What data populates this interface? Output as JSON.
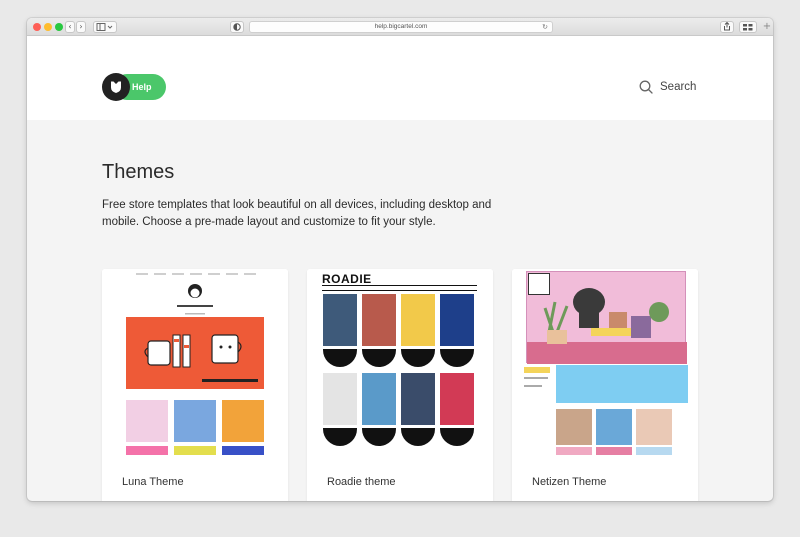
{
  "browser": {
    "url": "help.bigcartel.com",
    "back_glyph": "‹",
    "forward_glyph": "›",
    "reload_glyph": "↻",
    "new_tab_glyph": "+"
  },
  "header": {
    "logo_label": "Help",
    "search_label": "Search"
  },
  "main": {
    "title": "Themes",
    "description": "Free store templates that look beautiful on all devices, including desktop and mobile. Choose a pre-made layout and customize to fit your style."
  },
  "themes": [
    {
      "name": "Luna Theme"
    },
    {
      "name": "Roadie theme"
    },
    {
      "name": "Netizen Theme"
    }
  ],
  "thumbnails": {
    "roadie_logo": "ROADIE"
  },
  "colors": {
    "brand_green": "#4bc76a",
    "logo_dark": "#222222",
    "page_bg": "#f4f4f4",
    "luna_hero": "#ee5a37",
    "netizen_pink": "#f1bcd9"
  },
  "icons": {
    "logo": "bigcartel-shield-icon",
    "search": "search-icon"
  }
}
